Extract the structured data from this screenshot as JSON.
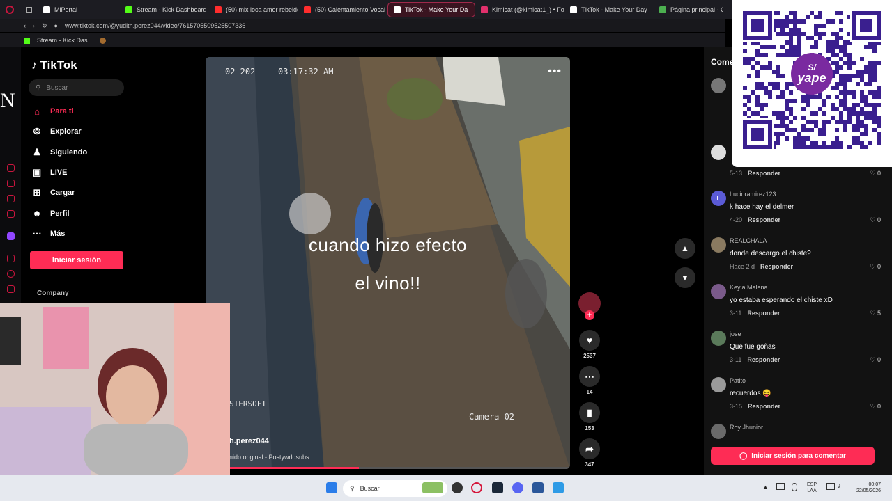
{
  "browser": {
    "tabs": [
      {
        "label": "MiPortal",
        "color": "#ffffff"
      },
      {
        "label": "Stream - Kick Dashboard",
        "color": "#53fc18"
      },
      {
        "label": "(50) mix loca amor rebelde",
        "color": "#ff2d2d"
      },
      {
        "label": "(50) Calentamiento Vocal",
        "color": "#ff2d2d"
      },
      {
        "label": "TikTok - Make Your Da",
        "color": "#ffffff",
        "active": true
      },
      {
        "label": "Kimicat (@kimicat1_) • Fo",
        "color": "#e1306c"
      },
      {
        "label": "TikTok - Make Your Day",
        "color": "#ffffff"
      },
      {
        "label": "Página principal - Goo",
        "color": "#4caf50"
      }
    ],
    "url": "www.tiktok.com/@yudith.perez044/video/7615705509525507336",
    "bookmarks": [
      {
        "label": "Stream - Kick Das..."
      }
    ]
  },
  "overlay_letter": "N",
  "tiktok": {
    "logo": "TikTok",
    "search_placeholder": "Buscar",
    "nav": [
      {
        "label": "Para ti",
        "icon": "home-icon",
        "active": true
      },
      {
        "label": "Explorar",
        "icon": "compass-icon"
      },
      {
        "label": "Siguiendo",
        "icon": "user-icon"
      },
      {
        "label": "LIVE",
        "icon": "live-icon"
      },
      {
        "label": "Cargar",
        "icon": "upload-icon"
      },
      {
        "label": "Perfil",
        "icon": "profile-icon"
      },
      {
        "label": "Más",
        "icon": "more-icon"
      }
    ],
    "login_label": "Iniciar sesión",
    "company_label": "Company"
  },
  "video": {
    "timestamp": "02-202",
    "time": "03:17:32 AM",
    "caption_line1": "cuando hizo efecto",
    "caption_line2": "el vino!!",
    "watermark": "STERSOFT",
    "camera_label": "Camera 02",
    "author": "h.perez044",
    "music": "nido original - Postywrldsubs",
    "progress": 0.42
  },
  "actions": {
    "likes": "2537",
    "comments": "14",
    "saves": "153",
    "shares": "347"
  },
  "comments": {
    "title": "Come",
    "first": {
      "date": "5-13",
      "reply": "Responder",
      "likes": "0"
    },
    "items": [
      {
        "avatar": "L",
        "user": "Lucioramirez123",
        "text": "k hace hay el delmer",
        "date": "4-20",
        "reply": "Responder",
        "likes": "0",
        "color": "#5b5bd6"
      },
      {
        "avatar": "",
        "user": "REALCHALA",
        "text": "donde descargo el chiste?",
        "date": "Hace 2 d",
        "reply": "Responder",
        "likes": "0",
        "color": "#8a7a60"
      },
      {
        "avatar": "",
        "user": "Keyla Malena",
        "text": "yo estaba esperando el chiste xD",
        "date": "3-11",
        "reply": "Responder",
        "likes": "5",
        "color": "#7a5a8a"
      },
      {
        "avatar": "",
        "user": "jose",
        "text": "Que fue goñas",
        "date": "3-11",
        "reply": "Responder",
        "likes": "0",
        "color": "#5a7a5a"
      },
      {
        "avatar": "",
        "user": "Patito",
        "text": "recuerdos 😝",
        "date": "3-15",
        "reply": "Responder",
        "likes": "0",
        "color": "#9a9a9a"
      },
      {
        "avatar": "",
        "user": "Roy Jhunior",
        "text": "",
        "date": "",
        "reply": "",
        "likes": "",
        "color": "#6a6a6a"
      }
    ],
    "login_label": "Iniciar sesión para comentar"
  },
  "qr": {
    "brand_symbol": "S/",
    "brand": "yape"
  },
  "taskbar": {
    "search_placeholder": "Buscar",
    "lang_line1": "ESP",
    "lang_line2": "LAA",
    "time": "00:07",
    "date": "22/05/2026"
  }
}
